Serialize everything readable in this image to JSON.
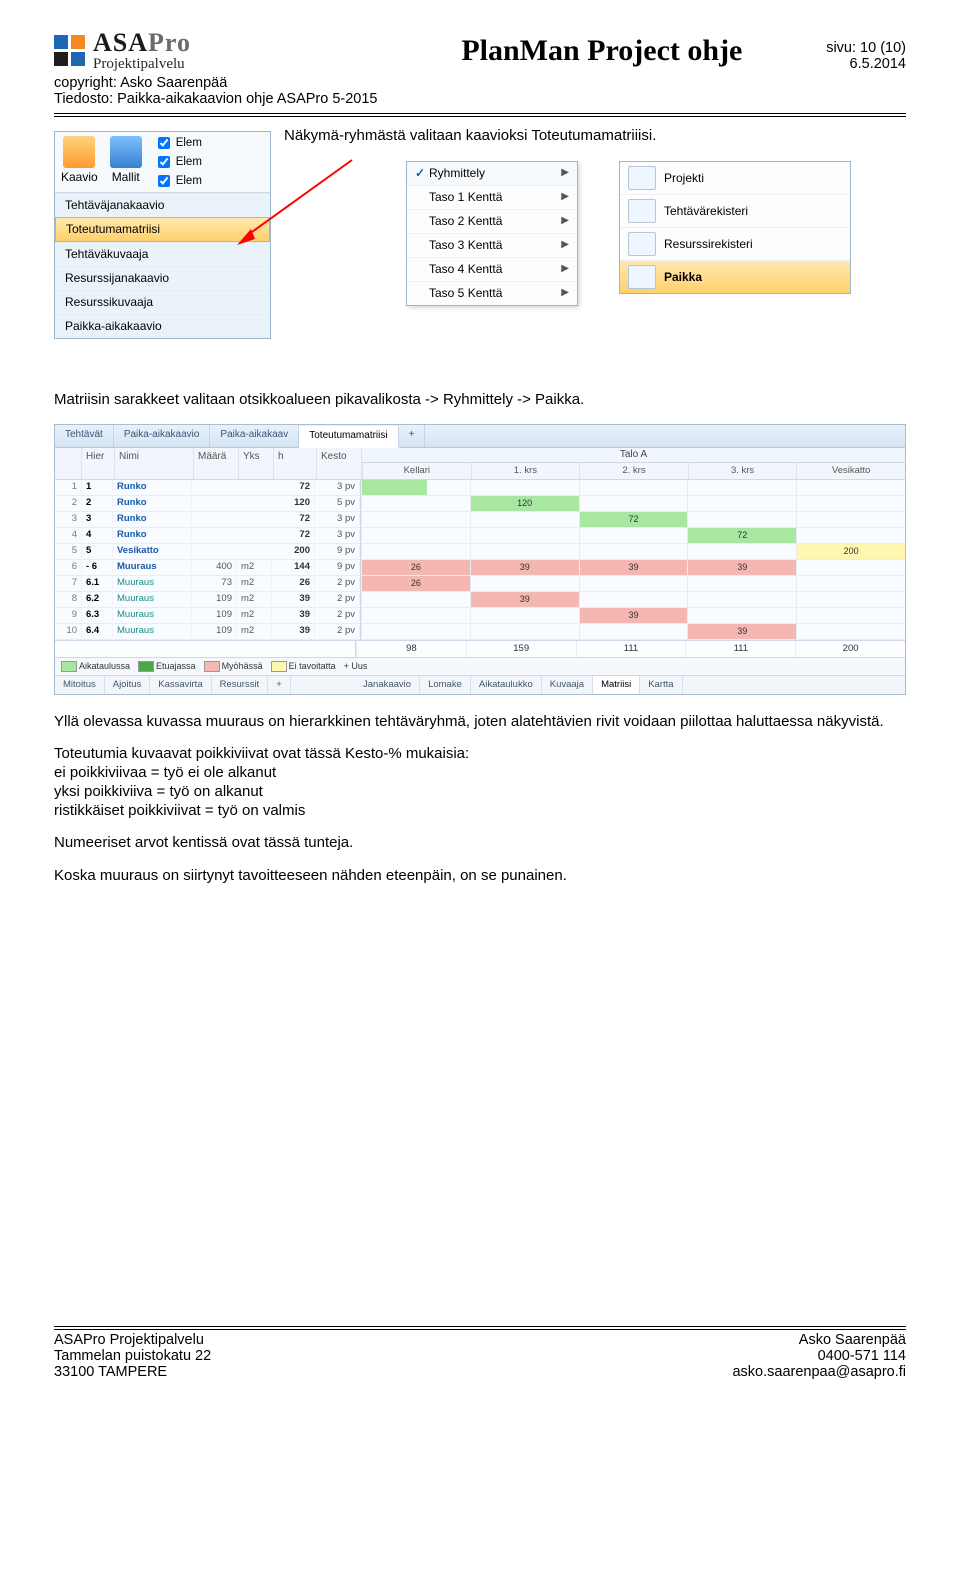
{
  "header": {
    "logo": {
      "main": "ASA",
      "sub": "Pro",
      "tagline": "Projektipalvelu"
    },
    "copyright": "copyright: Asko Saarenpää",
    "file": "Tiedosto: Paikka-aikakaavion ohje ASAPro 5-2015",
    "title": "PlanMan Project ohje",
    "page": "sivu: 10 (10)",
    "date": "6.5.2014"
  },
  "intro": "Näkymä-ryhmästä valitaan kaavioksi Toteutumamatriiisi.",
  "ribbon": {
    "buttons": [
      {
        "label": "Kaavio",
        "name": "kaavio-button"
      },
      {
        "label": "Mallit",
        "name": "mallit-button"
      }
    ],
    "checks": [
      "Elem",
      "Elem",
      "Elem"
    ],
    "views": [
      "Tehtäväjanakaavio",
      "Toteutumamatriisi",
      "Tehtäväkuvaaja",
      "Resurssijanakaavio",
      "Resurssikuvaaja",
      "Paikka-aikakaavio"
    ],
    "view_selected": 1
  },
  "popup": {
    "items": [
      {
        "label": "Ryhmittely",
        "checked": true
      },
      {
        "label": "Taso 1 Kenttä"
      },
      {
        "label": "Taso 2 Kenttä"
      },
      {
        "label": "Taso 3 Kenttä"
      },
      {
        "label": "Taso 4 Kenttä"
      },
      {
        "label": "Taso 5 Kenttä"
      }
    ]
  },
  "registries": {
    "items": [
      {
        "label": "Projekti",
        "icon": "project-icon"
      },
      {
        "label": "Tehtävärekisteri",
        "icon": "tasks-icon"
      },
      {
        "label": "Resurssirekisteri",
        "icon": "resources-icon"
      },
      {
        "label": "Paikka",
        "icon": "place-icon",
        "selected": true
      }
    ]
  },
  "para_after_fig1": "Matriisin sarakkeet valitaan otsikkoalueen pikavalikosta -> Ryhmittely -> Paikka.",
  "chart_data": {
    "type": "table",
    "title": "Toteutumamatriisi",
    "tabs": [
      "Tehtävät",
      "Paika-aikakaavio",
      "Paika-aikakaav",
      "Toteutumamatriisi",
      "+"
    ],
    "tabs_active": 3,
    "left_headers": [
      "Hier",
      "Nimi",
      "Määrä",
      "Yks",
      "h",
      "Kesto"
    ],
    "group_header": "Talo A",
    "col_headers": [
      "Kellari",
      "1. krs",
      "2. krs",
      "3. krs",
      "Vesikatto"
    ],
    "rows": [
      {
        "idx": 1,
        "hier": "1",
        "nimi": "Runko",
        "cls": "nimi-blue",
        "maara": "",
        "yks": "",
        "h": "72",
        "kesto": "3 pv",
        "cells": [
          {
            "c": "gh"
          },
          {},
          {},
          {},
          {}
        ]
      },
      {
        "idx": 2,
        "hier": "2",
        "nimi": "Runko",
        "cls": "nimi-blue",
        "maara": "",
        "yks": "",
        "h": "120",
        "kesto": "5 pv",
        "cells": [
          {},
          {
            "c": "g",
            "v": "120"
          },
          {},
          {},
          {}
        ]
      },
      {
        "idx": 3,
        "hier": "3",
        "nimi": "Runko",
        "cls": "nimi-blue",
        "maara": "",
        "yks": "",
        "h": "72",
        "kesto": "3 pv",
        "cells": [
          {},
          {},
          {
            "c": "g",
            "v": "72"
          },
          {},
          {}
        ]
      },
      {
        "idx": 4,
        "hier": "4",
        "nimi": "Runko",
        "cls": "nimi-blue",
        "maara": "",
        "yks": "",
        "h": "72",
        "kesto": "3 pv",
        "cells": [
          {},
          {},
          {},
          {
            "c": "g",
            "v": "72"
          },
          {}
        ]
      },
      {
        "idx": 5,
        "hier": "5",
        "nimi": "Vesikatto",
        "cls": "nimi-blue",
        "maara": "",
        "yks": "",
        "h": "200",
        "kesto": "9 pv",
        "cells": [
          {},
          {},
          {},
          {},
          {
            "c": "y",
            "v": "200"
          }
        ]
      },
      {
        "idx": 6,
        "hier": "- 6",
        "nimi": "Muuraus",
        "cls": "nimi-blue",
        "maara": "400",
        "yks": "m2",
        "h": "144",
        "kesto": "9 pv",
        "cells": [
          {
            "c": "p",
            "v": "26"
          },
          {
            "c": "p",
            "v": "39"
          },
          {
            "c": "p",
            "v": "39"
          },
          {
            "c": "p",
            "v": "39"
          },
          {}
        ]
      },
      {
        "idx": 7,
        "hier": "6.1",
        "nimi": "Muuraus",
        "cls": "nimi-teal",
        "maara": "73",
        "yks": "m2",
        "h": "26",
        "kesto": "2 pv",
        "cells": [
          {
            "c": "p",
            "v": "26"
          },
          {},
          {},
          {},
          {}
        ]
      },
      {
        "idx": 8,
        "hier": "6.2",
        "nimi": "Muuraus",
        "cls": "nimi-teal",
        "maara": "109",
        "yks": "m2",
        "h": "39",
        "kesto": "2 pv",
        "cells": [
          {},
          {
            "c": "p",
            "v": "39"
          },
          {},
          {},
          {}
        ]
      },
      {
        "idx": 9,
        "hier": "6.3",
        "nimi": "Muuraus",
        "cls": "nimi-teal",
        "maara": "109",
        "yks": "m2",
        "h": "39",
        "kesto": "2 pv",
        "cells": [
          {},
          {},
          {
            "c": "p",
            "v": "39"
          },
          {},
          {}
        ]
      },
      {
        "idx": 10,
        "hier": "6.4",
        "nimi": "Muuraus",
        "cls": "nimi-teal",
        "maara": "109",
        "yks": "m2",
        "h": "39",
        "kesto": "2 pv",
        "cells": [
          {},
          {},
          {},
          {
            "c": "p",
            "v": "39"
          },
          {}
        ]
      }
    ],
    "summary": [
      "98",
      "159",
      "111",
      "111",
      "200"
    ],
    "legend": [
      {
        "label": "Aikataulussa",
        "color": "#a8e6a1"
      },
      {
        "label": "Etuajassa",
        "color": "#4aa84a"
      },
      {
        "label": "Myöhässä",
        "color": "#f5b7b1"
      },
      {
        "label": "Ei tavoitatta",
        "color": "#fff6b0"
      }
    ],
    "legend_extra": "+ Uus",
    "bottom_tabs_left": [
      "Mitoitus",
      "Ajoitus",
      "Kassavirta",
      "Resurssit",
      "+"
    ],
    "bottom_tabs_right": [
      "Janakaavio",
      "Lomake",
      "Aikataulukko",
      "Kuvaaja",
      "Matriisi",
      "Kartta"
    ],
    "bottom_tabs_right_active": 4
  },
  "para_block": [
    "Yllä olevassa kuvassa muuraus on hierarkkinen tehtäväryhmä, joten alatehtävien rivit voidaan piilottaa haluttaessa näkyvistä.",
    "Toteutumia kuvaavat poikkiviivat ovat tässä Kesto-% mukaisia:",
    "ei poikkiviivaa = työ ei ole alkanut",
    "yksi poikkiviiva = työ on alkanut",
    "ristikkäiset poikkiviivat = työ on valmis",
    "Numeeriset arvot kentissä ovat tässä tunteja.",
    "Koska muuraus on siirtynyt tavoitteeseen nähden eteenpäin, on se punainen."
  ],
  "footer": {
    "left": [
      "ASAPro Projektipalvelu",
      "Tammelan puistokatu 22",
      "33100 TAMPERE"
    ],
    "right": [
      "Asko Saarenpää",
      "0400-571 114",
      "asko.saarenpaa@asapro.fi"
    ]
  }
}
